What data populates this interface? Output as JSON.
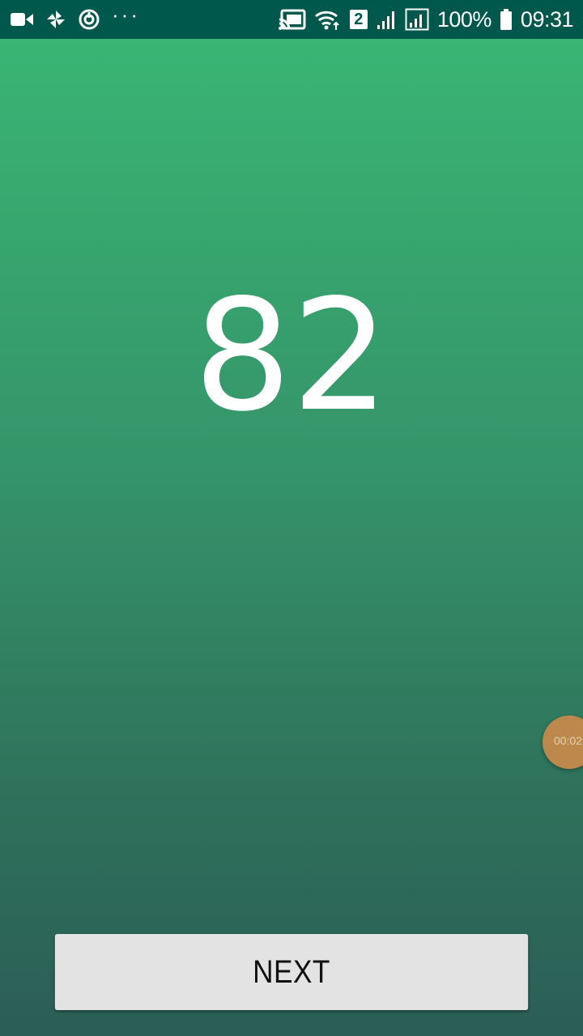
{
  "status_bar": {
    "left_icons": [
      "video-camera-icon",
      "pinwheel-icon",
      "sync-icon",
      "more-dots-icon"
    ],
    "more_dots": "···",
    "right_icons": [
      "cast-icon",
      "wifi-icon",
      "sim-2-icon",
      "signal-icon",
      "signal-sim-icon",
      "battery-icon"
    ],
    "sim_label": "2",
    "battery_percent": "100%",
    "time": "09:31"
  },
  "main": {
    "counter_value": "82"
  },
  "timer_bubble": {
    "text": "00:02"
  },
  "actions": {
    "next_label": "NEXT"
  },
  "colors": {
    "status_bar": "#00574b",
    "gradient_top": "#3ab874",
    "gradient_bottom": "#2b5e56",
    "button_bg": "#e3e3e3",
    "bubble": "#c98a4a"
  }
}
